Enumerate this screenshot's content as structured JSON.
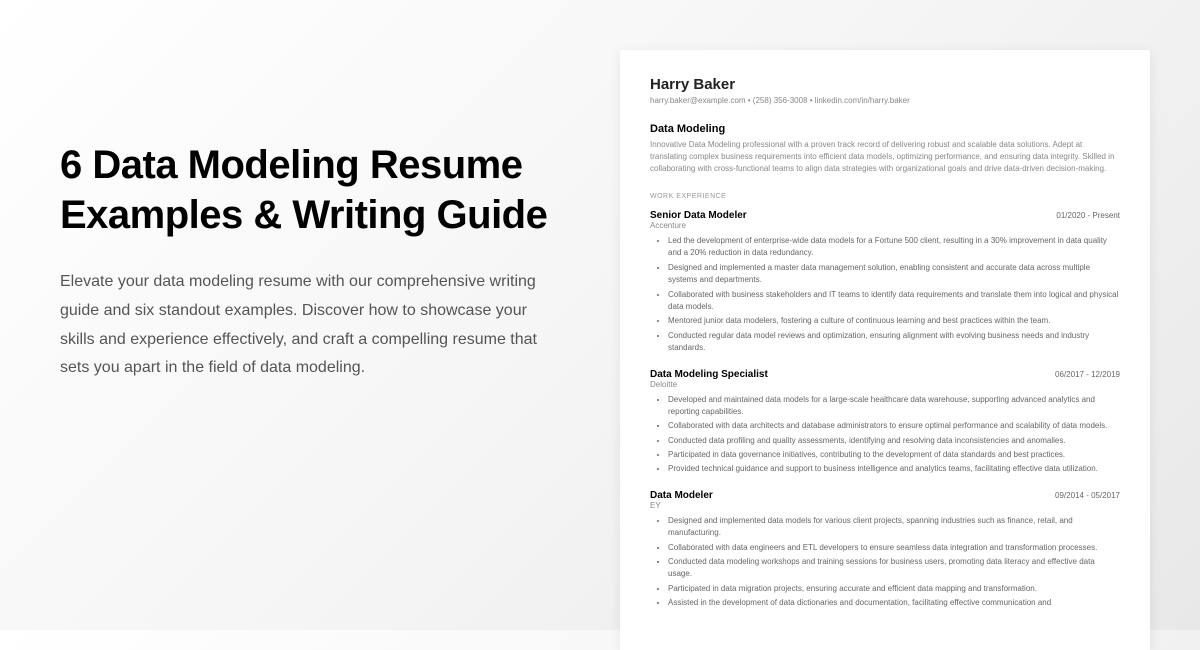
{
  "left": {
    "title": "6 Data Modeling Resume Examples & Writing Guide",
    "subtitle": "Elevate your data modeling resume with our comprehensive writing guide and six standout examples. Discover how to showcase your skills and experience effectively, and craft a compelling resume that sets you apart in the field of data modeling."
  },
  "resume": {
    "name": "Harry Baker",
    "contact": "harry.baker@example.com  •  (258) 356-3008  •  linkedin.com/in/harry.baker",
    "section_title": "Data Modeling",
    "summary": "Innovative Data Modeling professional with a proven track record of delivering robust and scalable data solutions. Adept at translating complex business requirements into efficient data models, optimizing performance, and ensuring data integrity. Skilled in collaborating with cross-functional teams to align data strategies with organizational goals and drive data-driven decision-making.",
    "work_label": "WORK EXPERIENCE",
    "jobs": [
      {
        "title": "Senior Data Modeler",
        "dates": "01/2020 - Present",
        "company": "Accenture",
        "bullets": [
          "Led the development of enterprise-wide data models for a Fortune 500 client, resulting in a 30% improvement in data quality and a 20% reduction in data redundancy.",
          "Designed and implemented a master data management solution, enabling consistent and accurate data across multiple systems and departments.",
          "Collaborated with business stakeholders and IT teams to identify data requirements and translate them into logical and physical data models.",
          "Mentored junior data modelers, fostering a culture of continuous learning and best practices within the team.",
          "Conducted regular data model reviews and optimization, ensuring alignment with evolving business needs and industry standards."
        ]
      },
      {
        "title": "Data Modeling Specialist",
        "dates": "06/2017 - 12/2019",
        "company": "Deloitte",
        "bullets": [
          "Developed and maintained data models for a large-scale healthcare data warehouse, supporting advanced analytics and reporting capabilities.",
          "Collaborated with data architects and database administrators to ensure optimal performance and scalability of data models.",
          "Conducted data profiling and quality assessments, identifying and resolving data inconsistencies and anomalies.",
          "Participated in data governance initiatives, contributing to the development of data standards and best practices.",
          "Provided technical guidance and support to business intelligence and analytics teams, facilitating effective data utilization."
        ]
      },
      {
        "title": "Data Modeler",
        "dates": "09/2014 - 05/2017",
        "company": "EY",
        "bullets": [
          "Designed and implemented data models for various client projects, spanning industries such as finance, retail, and manufacturing.",
          "Collaborated with data engineers and ETL developers to ensure seamless data integration and transformation processes.",
          "Conducted data modeling workshops and training sessions for business users, promoting data literacy and effective data usage.",
          "Participated in data migration projects, ensuring accurate and efficient data mapping and transformation.",
          "Assisted in the development of data dictionaries and documentation, facilitating effective communication and"
        ]
      }
    ]
  }
}
